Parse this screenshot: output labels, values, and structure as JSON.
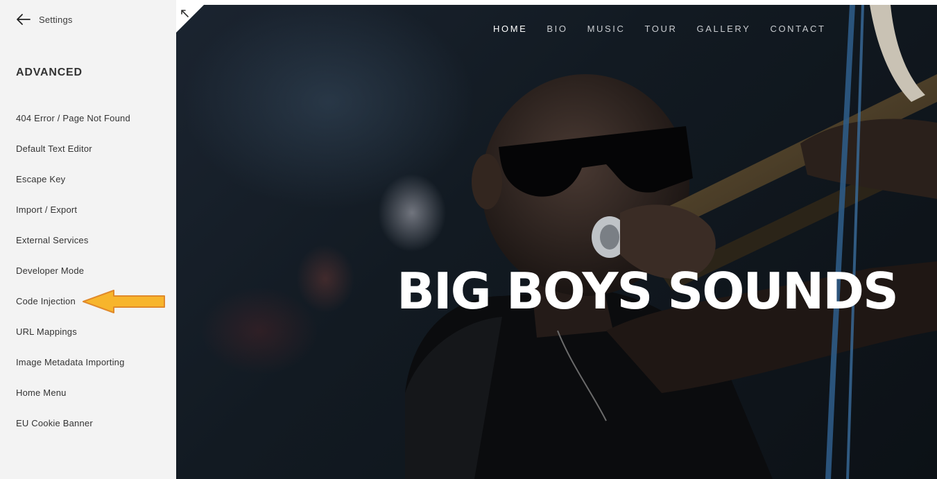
{
  "sidebar": {
    "back_label": "Settings",
    "section_title": "ADVANCED",
    "items": [
      {
        "label": "404 Error / Page Not Found"
      },
      {
        "label": "Default Text Editor"
      },
      {
        "label": "Escape Key"
      },
      {
        "label": "Import / Export"
      },
      {
        "label": "External Services"
      },
      {
        "label": "Developer Mode"
      },
      {
        "label": "Code Injection"
      },
      {
        "label": "URL Mappings"
      },
      {
        "label": "Image Metadata Importing"
      },
      {
        "label": "Home Menu"
      },
      {
        "label": "EU Cookie Banner"
      }
    ],
    "highlight_arrow_color": "#f7b52c"
  },
  "preview": {
    "nav": [
      {
        "label": "HOME",
        "active": true
      },
      {
        "label": "BIO"
      },
      {
        "label": "MUSIC"
      },
      {
        "label": "TOUR"
      },
      {
        "label": "GALLERY"
      },
      {
        "label": "CONTACT"
      }
    ],
    "hero_title": "BIG BOYS SOUNDS",
    "corner_icon": "expand-arrow-icon"
  }
}
